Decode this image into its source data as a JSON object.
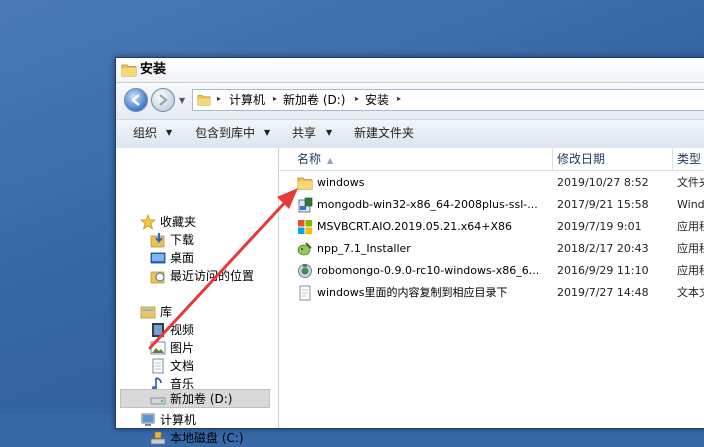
{
  "window": {
    "title": "安装"
  },
  "address": {
    "crumbs": [
      "计算机",
      "新加卷 (D:)",
      "安装"
    ]
  },
  "toolbar": {
    "organize": "组织",
    "include_in_library": "包含到库中",
    "share": "共享",
    "new_folder": "新建文件夹"
  },
  "navigation": {
    "favorites": {
      "label": "收藏夹",
      "items": [
        "下载",
        "桌面",
        "最近访问的位置"
      ]
    },
    "libraries": {
      "label": "库",
      "items": [
        "视频",
        "图片",
        "文档",
        "音乐"
      ]
    },
    "computer": {
      "label": "计算机",
      "items": [
        "本地磁盘 (C:)",
        "新加卷 (D:)"
      ]
    }
  },
  "columns": {
    "name": "名称",
    "date": "修改日期",
    "type": "类型"
  },
  "files": [
    {
      "name": "windows",
      "date": "2019/10/27 8:52",
      "type": "文件夹",
      "icon": "folder-icon"
    },
    {
      "name": "mongodb-win32-x86_64-2008plus-ssl-...",
      "date": "2017/9/21 15:58",
      "type": "Windo",
      "icon": "installer-icon"
    },
    {
      "name": "MSVBCRT.AIO.2019.05.21.x64+X86",
      "date": "2019/7/19 9:01",
      "type": "应用程",
      "icon": "windows-app-icon"
    },
    {
      "name": "npp_7.1_Installer",
      "date": "2018/2/17 20:43",
      "type": "应用程",
      "icon": "notepadpp-icon"
    },
    {
      "name": "robomongo-0.9.0-rc10-windows-x86_6...",
      "date": "2016/9/29 11:10",
      "type": "应用程",
      "icon": "robomongo-icon"
    },
    {
      "name": "windows里面的内容复制到相应目录下",
      "date": "2019/7/27 14:48",
      "type": "文本文",
      "icon": "text-document-icon"
    }
  ],
  "annotation": {
    "arrow_color": "#e8383a"
  }
}
